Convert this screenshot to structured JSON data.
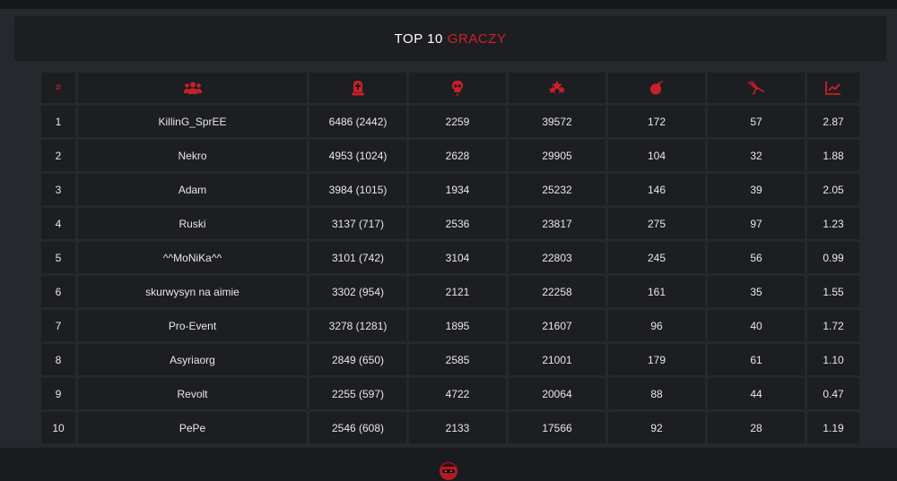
{
  "header": {
    "title_main": "TOP 10",
    "title_accent": "GRACZY"
  },
  "colors": {
    "accent": "#d1202a",
    "background": "#26282d",
    "cell": "#1d1e22"
  },
  "table": {
    "rank_header": "#",
    "columns": [
      {
        "key": "player",
        "icon": "group-icon"
      },
      {
        "key": "kills",
        "icon": "tombstone-icon"
      },
      {
        "key": "deaths",
        "icon": "skull-icon"
      },
      {
        "key": "points",
        "icon": "stars-icon"
      },
      {
        "key": "bombs",
        "icon": "bomb-icon"
      },
      {
        "key": "defuses",
        "icon": "pliers-icon"
      },
      {
        "key": "ratio",
        "icon": "chart-icon"
      }
    ],
    "rows": [
      {
        "rank": "1",
        "name": "KillinG_SprEE",
        "kills": "6486 (2442)",
        "deaths": "2259",
        "points": "39572",
        "bombs": "172",
        "defuses": "57",
        "ratio": "2.87"
      },
      {
        "rank": "2",
        "name": "Nekro",
        "kills": "4953 (1024)",
        "deaths": "2628",
        "points": "29905",
        "bombs": "104",
        "defuses": "32",
        "ratio": "1.88"
      },
      {
        "rank": "3",
        "name": "Adam",
        "kills": "3984 (1015)",
        "deaths": "1934",
        "points": "25232",
        "bombs": "146",
        "defuses": "39",
        "ratio": "2.05"
      },
      {
        "rank": "4",
        "name": "Ruski",
        "kills": "3137 (717)",
        "deaths": "2536",
        "points": "23817",
        "bombs": "275",
        "defuses": "97",
        "ratio": "1.23"
      },
      {
        "rank": "5",
        "name": "^^MoNiKa^^",
        "kills": "3101 (742)",
        "deaths": "3104",
        "points": "22803",
        "bombs": "245",
        "defuses": "56",
        "ratio": "0.99"
      },
      {
        "rank": "6",
        "name": "skurwysyn na aimie",
        "kills": "3302 (954)",
        "deaths": "2121",
        "points": "22258",
        "bombs": "161",
        "defuses": "35",
        "ratio": "1.55"
      },
      {
        "rank": "7",
        "name": "Pro-Event",
        "kills": "3278 (1281)",
        "deaths": "1895",
        "points": "21607",
        "bombs": "96",
        "defuses": "40",
        "ratio": "1.72"
      },
      {
        "rank": "8",
        "name": "Asyriaorg",
        "kills": "2849 (650)",
        "deaths": "2585",
        "points": "21001",
        "bombs": "179",
        "defuses": "61",
        "ratio": "1.10"
      },
      {
        "rank": "9",
        "name": "Revolt",
        "kills": "2255 (597)",
        "deaths": "4722",
        "points": "20064",
        "bombs": "88",
        "defuses": "44",
        "ratio": "0.47"
      },
      {
        "rank": "10",
        "name": "PePe",
        "kills": "2546 (608)",
        "deaths": "2133",
        "points": "17566",
        "bombs": "92",
        "defuses": "28",
        "ratio": "1.19"
      }
    ]
  },
  "footer": {
    "logo_icon": "mascot-logo-icon"
  }
}
